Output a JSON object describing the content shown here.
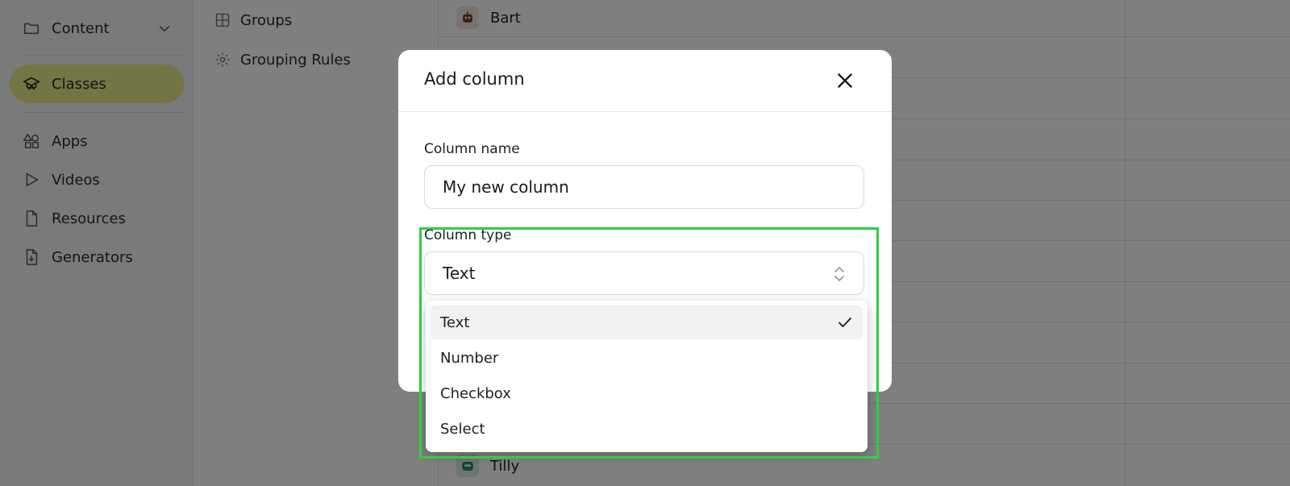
{
  "sidebar": {
    "items": [
      {
        "label": "Content",
        "icon": "folder-icon"
      },
      {
        "label": "Classes",
        "icon": "graduation-cap-icon",
        "active": true
      },
      {
        "label": "Apps",
        "icon": "shapes-icon"
      },
      {
        "label": "Videos",
        "icon": "play-icon"
      },
      {
        "label": "Resources",
        "icon": "file-icon"
      },
      {
        "label": "Generators",
        "icon": "file-download-icon"
      }
    ]
  },
  "subnav": {
    "items": [
      {
        "label": "Groups",
        "icon": "grid-icon"
      },
      {
        "label": "Grouping Rules",
        "icon": "gear-icon"
      }
    ]
  },
  "students": {
    "first": "Bart",
    "last": "Tilly"
  },
  "modal": {
    "title": "Add column",
    "name_label": "Column name",
    "name_value": "My new column",
    "type_label": "Column type",
    "type_value": "Text",
    "options": [
      "Text",
      "Number",
      "Checkbox",
      "Select"
    ],
    "selected_option": "Text"
  },
  "colors": {
    "active_nav": "#e8eb8a",
    "highlight": "#33cc44"
  }
}
